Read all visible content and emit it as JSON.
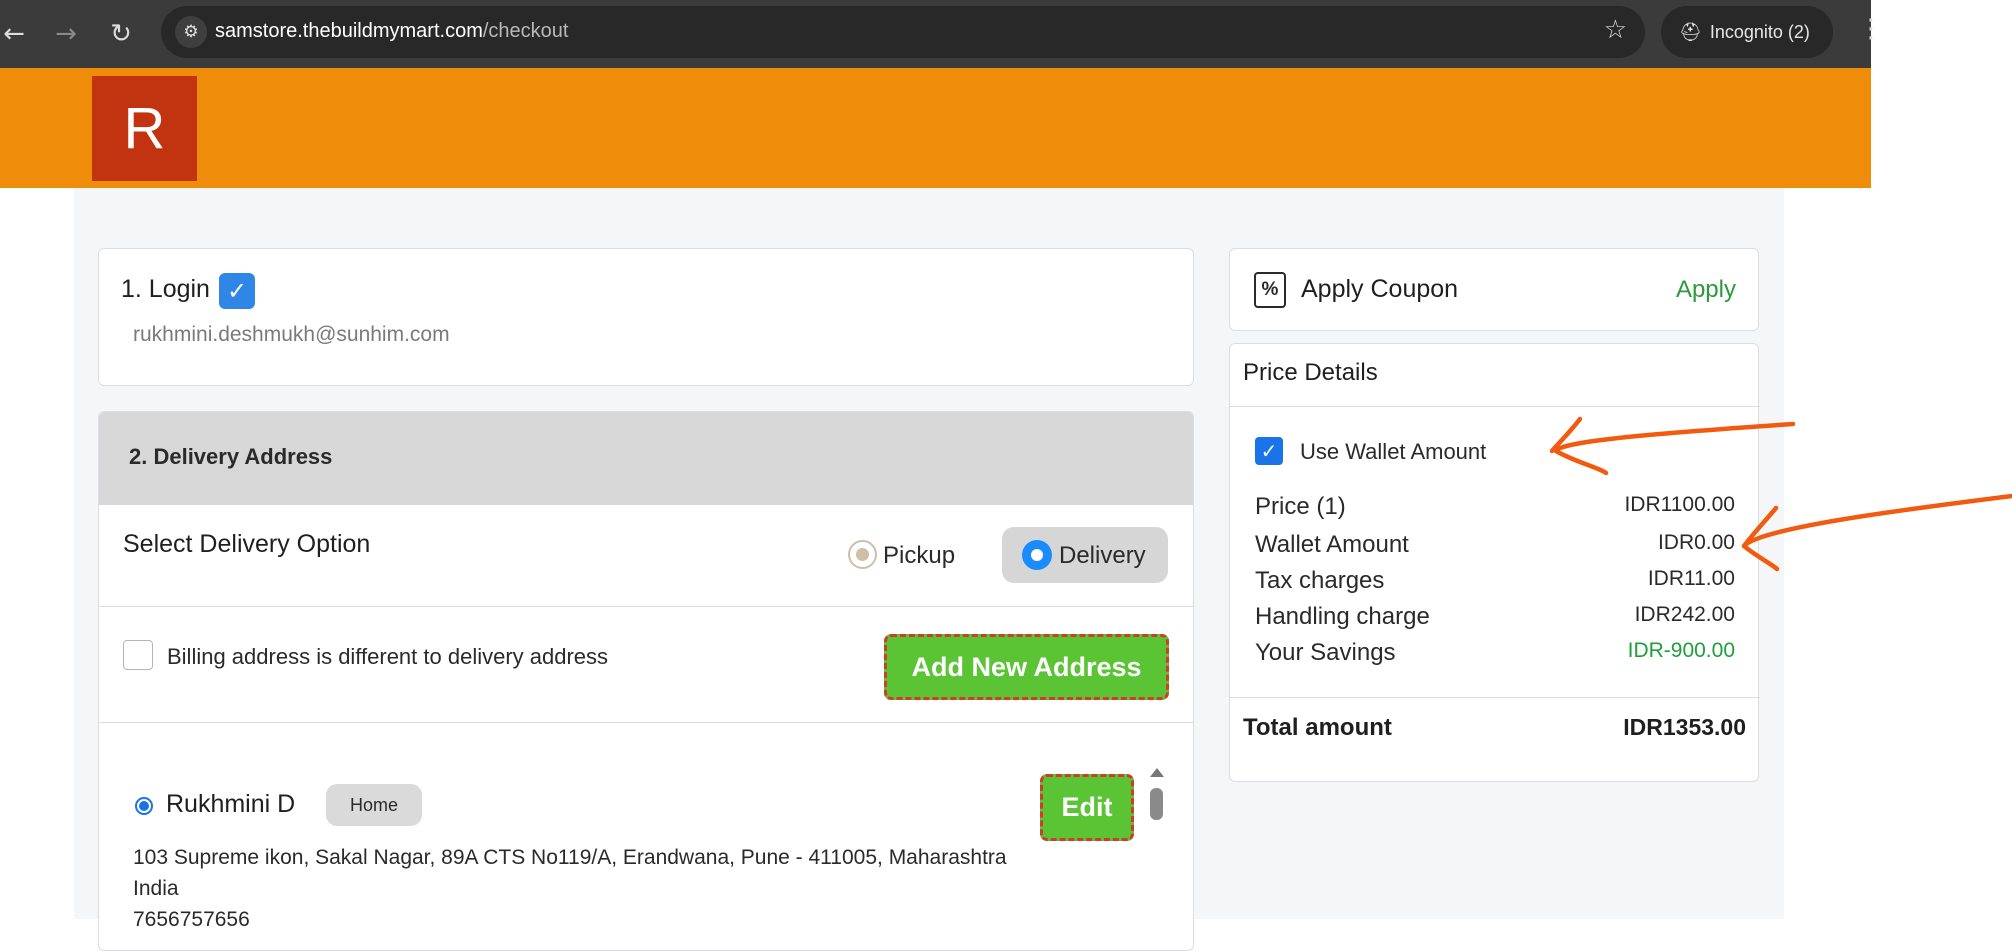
{
  "browser": {
    "url_host": "samstore.thebuildmymart.com",
    "url_path": "/checkout",
    "incognito_label": "Incognito (2)",
    "icons": {
      "back": "back-arrow-icon",
      "forward": "forward-arrow-icon",
      "reload": "reload-icon",
      "site_info": "tune-icon",
      "bookmark": "star-icon",
      "incognito": "incognito-icon",
      "menu": "kebab-menu-icon"
    }
  },
  "header": {
    "logo_letter": "R",
    "brand_color": "#ef8d0b",
    "logo_color": "#c2330f"
  },
  "login": {
    "title": "1. Login",
    "email": "rukhmini.deshmukh@sunhim.com",
    "verified": true
  },
  "delivery": {
    "title": "2. Delivery Address",
    "select_label": "Select Delivery Option",
    "options": [
      {
        "label": "Pickup",
        "selected": false
      },
      {
        "label": "Delivery",
        "selected": true
      }
    ],
    "billing_label": "Billing address is different to delivery address",
    "billing_checked": false,
    "add_address_label": "Add New Address",
    "address": {
      "name": "Rukhmini D",
      "tag": "Home",
      "line1": "103 Supreme ikon, Sakal Nagar, 89A CTS No119/A, Erandwana, Pune - 411005, Maharashtra",
      "line2": "India",
      "phone": "7656757656",
      "edit_label": "Edit",
      "selected": true
    }
  },
  "coupon": {
    "title": "Apply Coupon",
    "apply_label": "Apply",
    "icon": "coupon-icon"
  },
  "price_details": {
    "title": "Price Details",
    "wallet_label": "Use Wallet Amount",
    "wallet_checked": true,
    "rows": [
      {
        "label": "Price (1)",
        "value": "IDR1100.00"
      },
      {
        "label": "Wallet Amount",
        "value": "IDR0.00"
      },
      {
        "label": "Tax charges",
        "value": "IDR11.00"
      },
      {
        "label": "Handling charge",
        "value": "IDR242.00"
      },
      {
        "label": "Your Savings",
        "value": "IDR-900.00"
      }
    ],
    "total_label": "Total amount",
    "total_value": "IDR1353.00"
  },
  "colors": {
    "accent_green": "#5ac434",
    "annotation_orange": "#f25a0f",
    "savings_green": "#1f9e3c",
    "checkbox_blue": "#1a73e8"
  }
}
